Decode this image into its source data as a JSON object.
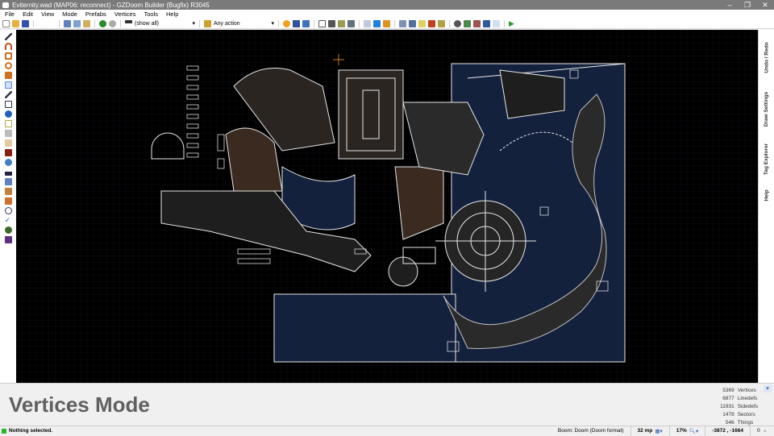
{
  "window": {
    "title": "Eviternity.wad (MAP06: reconnect) - GZDoom Builder (Bugfix) R3045",
    "minimize": "–",
    "maximize": "❐",
    "close": "✕"
  },
  "menu": [
    "File",
    "Edit",
    "View",
    "Mode",
    "Prefabs",
    "Vertices",
    "Tools",
    "Help"
  ],
  "toolbar": {
    "filter_value": "(show all)",
    "action_value": "Any action"
  },
  "right_tabs": [
    "Undo / Redo",
    "Draw Settings",
    "Tag Explorer",
    "Help"
  ],
  "info": {
    "mode_title": "Vertices Mode",
    "stats": [
      {
        "value": "5369",
        "label": "Vertices"
      },
      {
        "value": "6877",
        "label": "Linedefs"
      },
      {
        "value": "11931",
        "label": "Sidedefs"
      },
      {
        "value": "1478",
        "label": "Sectors"
      },
      {
        "value": "546",
        "label": "Things"
      }
    ]
  },
  "status": {
    "message": "Nothing selected.",
    "format": "Boom: Doom (Doom format)",
    "grid": "32 mp",
    "zoom": "17%",
    "coords": "-3872 , -1664",
    "warnings": "0"
  },
  "colors": {
    "canvas": "#000000",
    "lines": "#ffffff",
    "water": "#1c2a4a",
    "status_ok": "#2cb52c"
  }
}
